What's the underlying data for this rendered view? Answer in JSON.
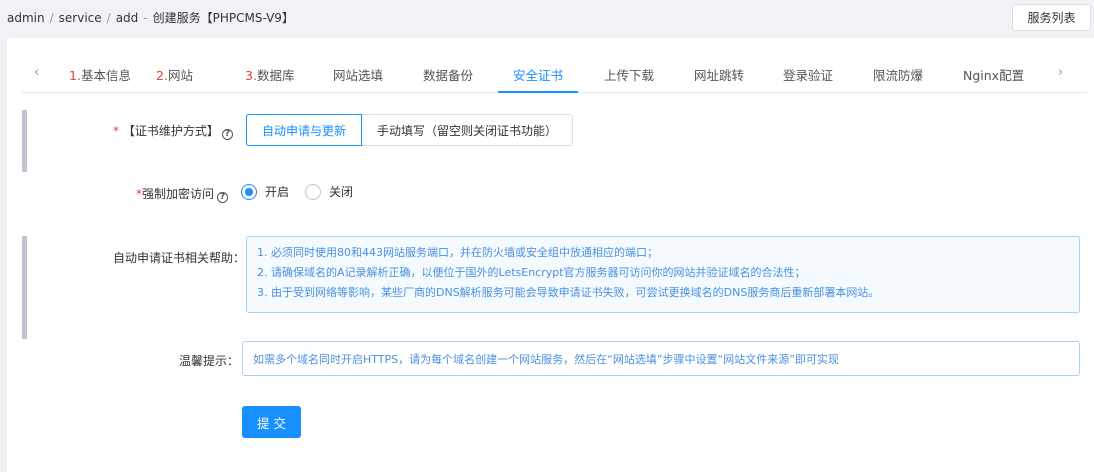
{
  "breadcrumb": [
    "admin",
    "service",
    "add"
  ],
  "page_title": "创建服务【PHPCMS-V9】",
  "header": {
    "list_button": "服务列表"
  },
  "tabs": [
    {
      "num": "1.",
      "label": "基本信息"
    },
    {
      "num": "2.",
      "label": "网站"
    },
    {
      "num": "3.",
      "label": "数据库"
    },
    {
      "num": "",
      "label": "网站选填"
    },
    {
      "num": "",
      "label": "数据备份"
    },
    {
      "num": "",
      "label": "安全证书",
      "active": true
    },
    {
      "num": "",
      "label": "上传下载"
    },
    {
      "num": "",
      "label": "网址跳转"
    },
    {
      "num": "",
      "label": "登录验证"
    },
    {
      "num": "",
      "label": "限流防爆"
    },
    {
      "num": "",
      "label": "Nginx配置"
    }
  ],
  "form": {
    "cert_method": {
      "required_mark": "*",
      "label": "【证书维护方式】",
      "options": [
        "自动申请与更新",
        "手动填写（留空则关闭证书功能）"
      ],
      "selected": "自动申请与更新"
    },
    "force_https": {
      "required_mark": "*",
      "label": "强制加密访问",
      "options": [
        "开启",
        "关闭"
      ],
      "selected": "开启"
    },
    "help": {
      "label": "自动申请证书相关帮助：",
      "lines": [
        "1. 必须同时使用80和443网站服务端口，并在防火墙或安全组中放通相应的端口；",
        "2. 请确保域名的A记录解析正确，以便位于国外的LetsEncrypt官方服务器可访问你的网站并验证域名的合法性；",
        "3. 由于受到网络等影响，某些厂商的DNS解析服务可能会导致申请证书失败，可尝试更换域名的DNS服务商后重新部署本网站。"
      ]
    },
    "tip": {
      "label": "温馨提示：",
      "text": "如需多个域名同时开启HTTPS，请为每个域名创建一个网站服务，然后在“网站选填”步骤中设置“网站文件来源”即可实现"
    },
    "submit_label": "提 交"
  },
  "colors": {
    "accent": "#1890ff",
    "required": "#e6413c",
    "help_text": "#4a90e2"
  },
  "icons": {
    "question": "question-circle-icon",
    "tab_prev": "chevron-left-icon",
    "tab_next": "chevron-right-icon"
  }
}
